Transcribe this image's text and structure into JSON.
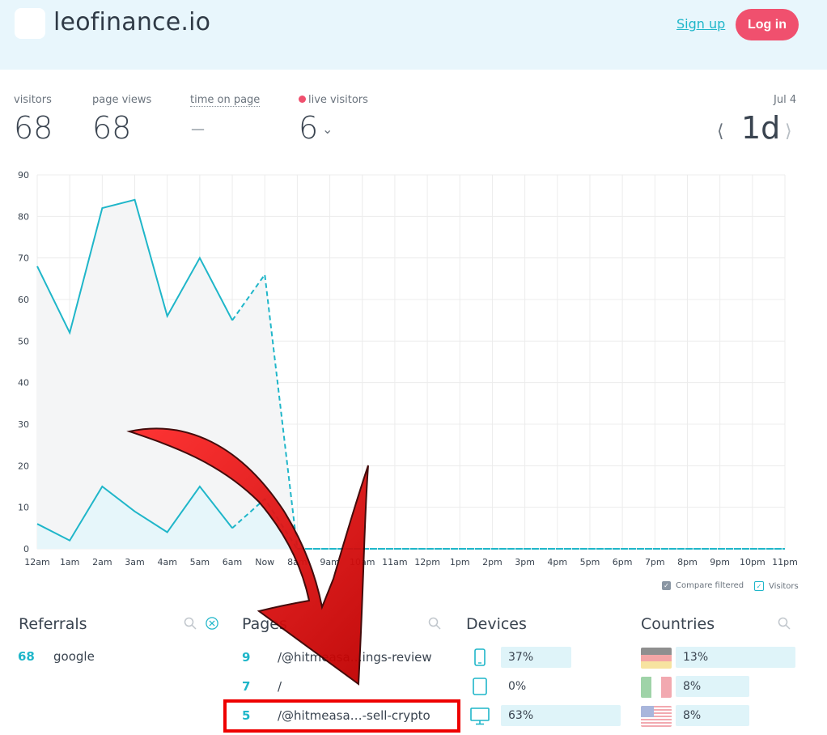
{
  "header": {
    "site_name": "leofinance.io",
    "signup_label": "Sign up",
    "login_label": "Log in"
  },
  "stats": {
    "visitors_label": "visitors",
    "visitors_value": "68",
    "pageviews_label": "page views",
    "pageviews_value": "68",
    "time_label": "time on page",
    "time_value": "–",
    "live_label": "live visitors",
    "live_value": "6",
    "date": "Jul 4",
    "period": "1d"
  },
  "chart_data": {
    "type": "line",
    "categories": [
      "12am",
      "1am",
      "2am",
      "3am",
      "4am",
      "5am",
      "6am",
      "Now",
      "8am",
      "9am",
      "10am",
      "11am",
      "12pm",
      "1pm",
      "2pm",
      "3pm",
      "4pm",
      "5pm",
      "6pm",
      "7pm",
      "8pm",
      "9pm",
      "10pm",
      "11pm"
    ],
    "ylim": [
      0,
      90
    ],
    "yticks": [
      0,
      10,
      20,
      30,
      40,
      50,
      60,
      70,
      80,
      90
    ],
    "grid": true,
    "series": [
      {
        "name": "Compare filtered",
        "values": [
          68,
          52,
          82,
          84,
          56,
          70,
          55,
          66,
          0,
          0,
          0,
          0,
          0,
          0,
          0,
          0,
          0,
          0,
          0,
          0,
          0,
          0,
          0,
          0
        ]
      },
      {
        "name": "Visitors",
        "values": [
          6,
          2,
          15,
          9,
          4,
          15,
          5,
          12,
          0,
          0,
          0,
          0,
          0,
          0,
          0,
          0,
          0,
          0,
          0,
          0,
          0,
          0,
          0,
          0
        ]
      }
    ],
    "legend_position": "bottom-right",
    "colors": {
      "line": "#1fb6c9",
      "area_compare": "#f4f5f6",
      "area_visitors": "#e6f6fa"
    }
  },
  "legend": {
    "compare_label": "Compare filtered",
    "visitors_label": "Visitors"
  },
  "referrals": {
    "title": "Referrals",
    "items": [
      {
        "count": "68",
        "label": "google"
      }
    ]
  },
  "pages": {
    "title": "Pages",
    "items": [
      {
        "count": "9",
        "label": "/@hitmeasa…ings-review"
      },
      {
        "count": "7",
        "label": "/"
      },
      {
        "count": "5",
        "label": "/@hitmeasa…-sell-crypto"
      }
    ]
  },
  "devices": {
    "title": "Devices",
    "items": [
      {
        "icon": "phone-icon",
        "pct": "37%",
        "value": 37
      },
      {
        "icon": "tablet-icon",
        "pct": "0%",
        "value": 0
      },
      {
        "icon": "desktop-icon",
        "pct": "63%",
        "value": 63
      }
    ]
  },
  "countries": {
    "title": "Countries",
    "items": [
      {
        "flag": "germany",
        "pct": "13%",
        "value": 13
      },
      {
        "flag": "italy",
        "pct": "8%",
        "value": 8
      },
      {
        "flag": "usa",
        "pct": "8%",
        "value": 8
      }
    ]
  }
}
